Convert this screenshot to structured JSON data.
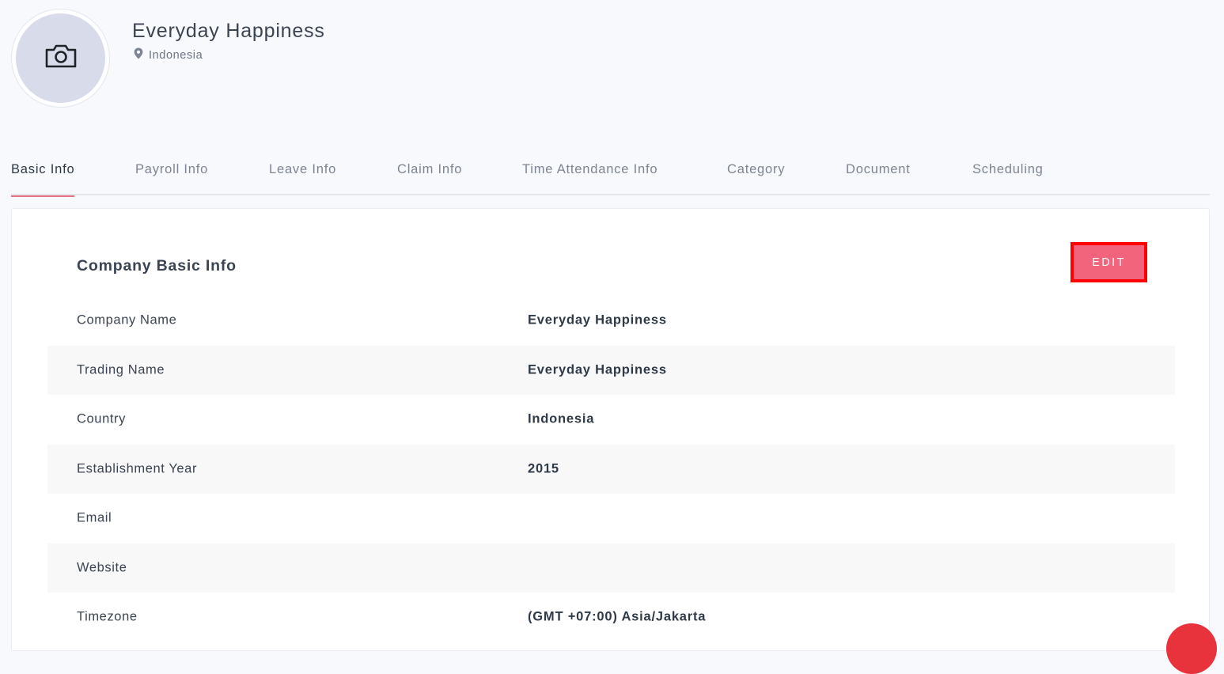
{
  "profile": {
    "company_name": "Everyday Happiness",
    "location": "Indonesia",
    "avatar_icon": "camera-icon",
    "location_icon": "map-pin-icon"
  },
  "tabs": [
    {
      "label": "Basic Info",
      "active": true
    },
    {
      "label": "Payroll Info",
      "active": false
    },
    {
      "label": "Leave Info",
      "active": false
    },
    {
      "label": "Claim Info",
      "active": false
    },
    {
      "label": "Time Attendance Info",
      "active": false
    },
    {
      "label": "Category",
      "active": false
    },
    {
      "label": "Document",
      "active": false
    },
    {
      "label": "Scheduling",
      "active": false
    }
  ],
  "section": {
    "title": "Company Basic Info",
    "edit_label": "EDIT"
  },
  "fields": [
    {
      "label": "Company Name",
      "value": "Everyday Happiness"
    },
    {
      "label": "Trading Name",
      "value": "Everyday Happiness"
    },
    {
      "label": "Country",
      "value": "Indonesia"
    },
    {
      "label": "Establishment Year",
      "value": "2015"
    },
    {
      "label": "Email",
      "value": ""
    },
    {
      "label": "Website",
      "value": ""
    },
    {
      "label": "Timezone",
      "value": "(GMT +07:00) Asia/Jakarta"
    }
  ],
  "colors": {
    "accent": "#f2647c",
    "tab_underline": "#e8717f",
    "highlight_outline": "#ff0000",
    "fab": "#e8323c"
  }
}
